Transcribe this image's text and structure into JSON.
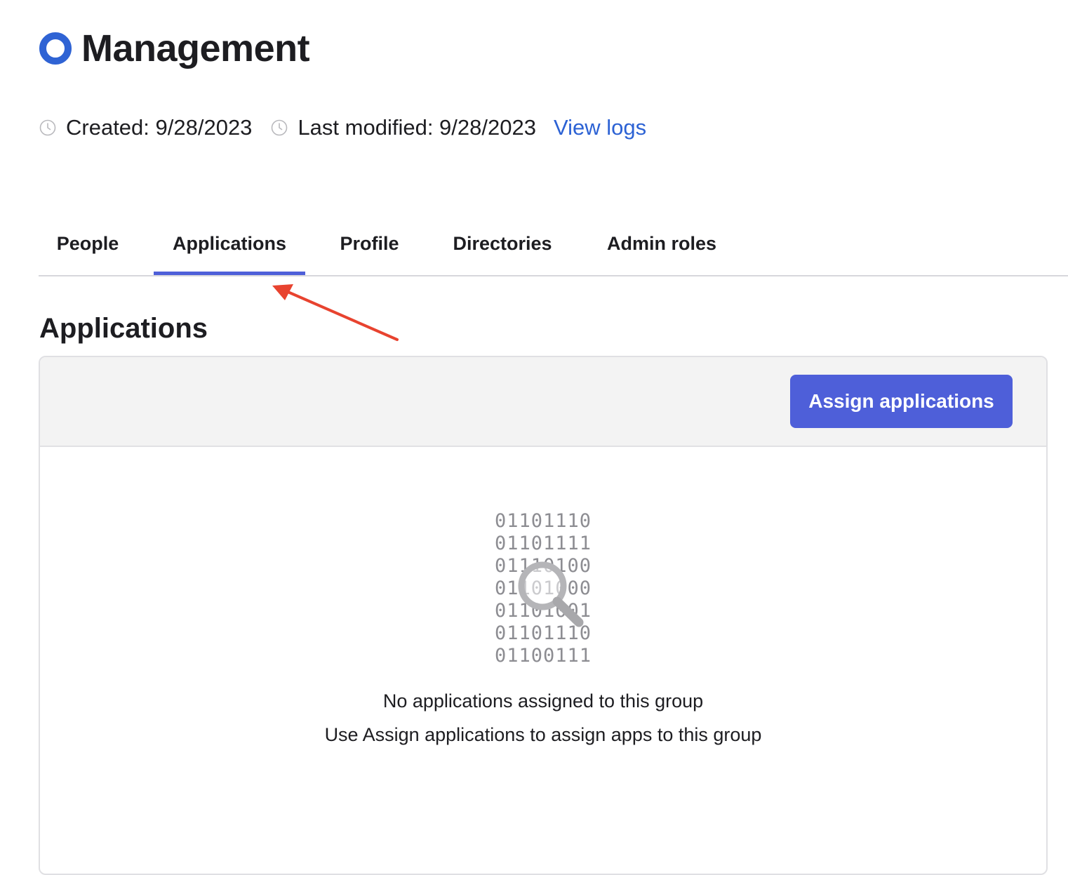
{
  "header": {
    "title": "Management",
    "icon": "group-circle-icon",
    "accent_color": "#2f63d4"
  },
  "meta": {
    "created": "Created: 9/28/2023",
    "last_modified": "Last modified: 9/28/2023",
    "view_logs_label": "View logs"
  },
  "tabs": [
    {
      "label": "People",
      "active": false
    },
    {
      "label": "Applications",
      "active": true
    },
    {
      "label": "Profile",
      "active": false
    },
    {
      "label": "Directories",
      "active": false
    },
    {
      "label": "Admin roles",
      "active": false
    }
  ],
  "section": {
    "title": "Applications"
  },
  "toolbar": {
    "assign_label": "Assign applications",
    "button_color": "#4e5fd9"
  },
  "empty_state": {
    "binary_lines": [
      "01101110",
      "01101111",
      "01110100",
      "01101000",
      "01101001",
      "01101110",
      "01100111"
    ],
    "icon": "magnifier-icon",
    "title": "No applications assigned to this group",
    "subtitle": "Use Assign applications to assign apps to this group"
  },
  "annotation": {
    "arrow_color": "#e8432f",
    "points_to": "Applications tab"
  }
}
